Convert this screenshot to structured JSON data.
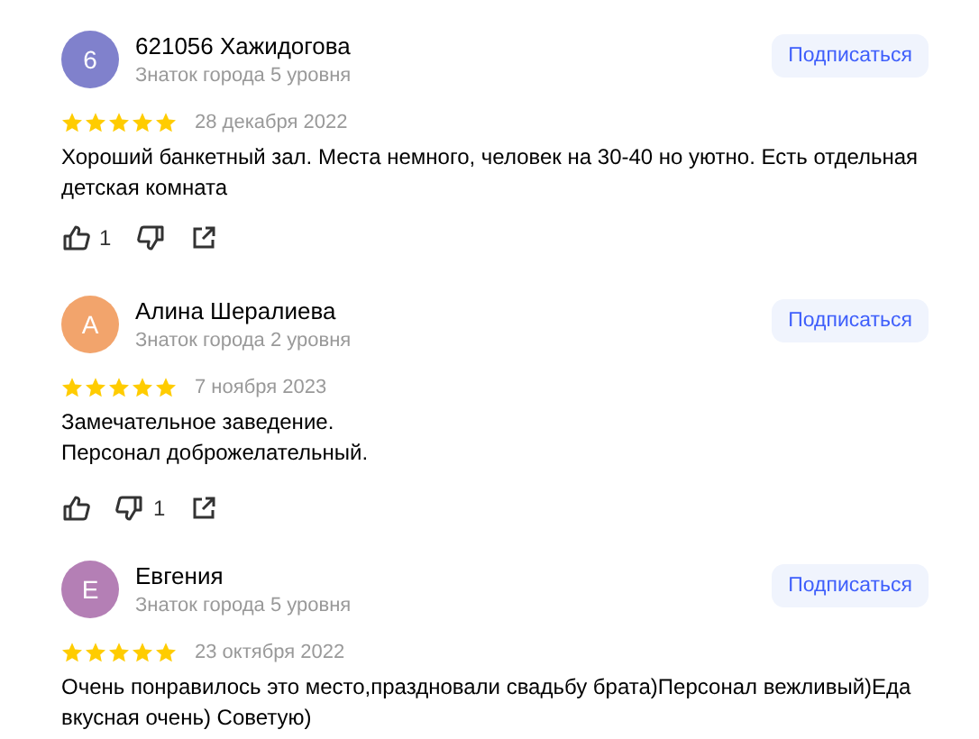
{
  "reviews": [
    {
      "avatar_letter": "6",
      "color": "#8081cc",
      "name": "621056 Хажидогова",
      "level": "Знаток города 5 уровня",
      "subscribe": "Подписаться",
      "stars": 5,
      "date": "28 декабря 2022",
      "text": "Хороший банкетный зал. Места немного, человек на 30-40 но уютно. Есть отдельная детская комната",
      "likes": "1"
    },
    {
      "avatar_letter": "А",
      "color": "#f2a46c",
      "name": "Алина Шералиева",
      "level": "Знаток города 2 уровня",
      "subscribe": "Подписаться",
      "stars": 5,
      "date": "7 ноября 2023",
      "text": "Замечательное заведение.\nПерсонал доброжелательный.",
      "dislikes": "1"
    },
    {
      "avatar_letter": "Е",
      "color": "#b47fb5",
      "name": "Евгения",
      "level": "Знаток города 5 уровня",
      "subscribe": "Подписаться",
      "stars": 5,
      "date": "23 октября 2022",
      "text": "Очень понравилось это место,праздновали свадьбу брата)Персонал вежливый)Еда вкусная очень) Советую)"
    }
  ]
}
